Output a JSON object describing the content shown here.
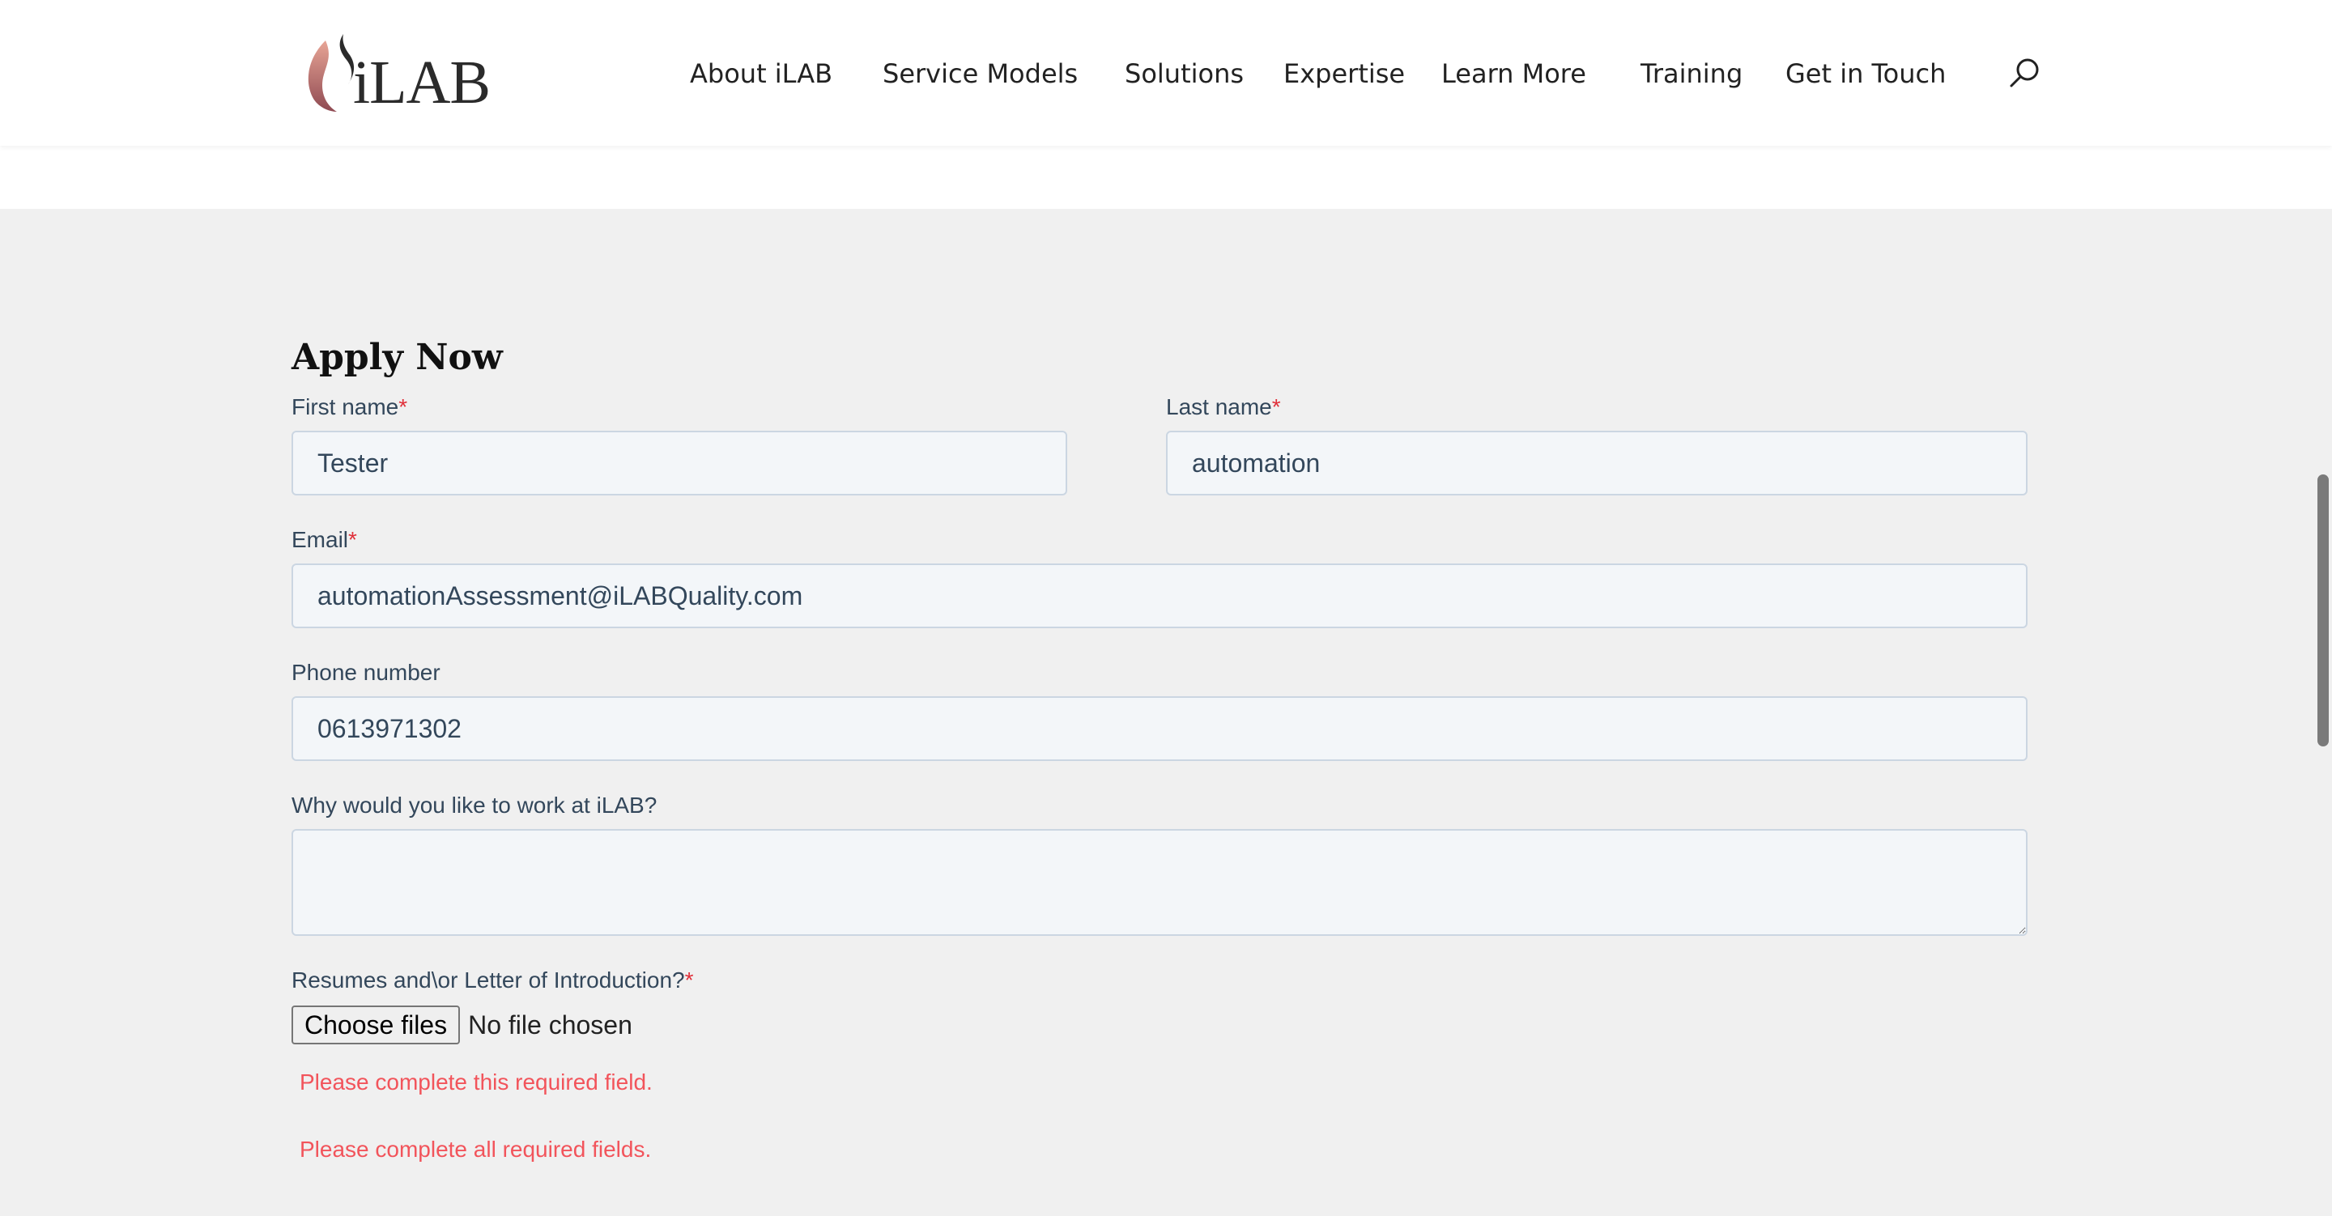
{
  "header": {
    "logo_text": "iLAB",
    "nav": [
      {
        "label": "About iLAB"
      },
      {
        "label": "Service Models"
      },
      {
        "label": "Solutions"
      },
      {
        "label": "Expertise"
      },
      {
        "label": "Learn More"
      },
      {
        "label": "Training"
      },
      {
        "label": "Get in Touch"
      }
    ],
    "search_icon": "search-icon"
  },
  "form": {
    "title": "Apply Now",
    "required_marker": "*",
    "first_name": {
      "label": "First name",
      "value": "Tester"
    },
    "last_name": {
      "label": "Last name",
      "value": "automation"
    },
    "email": {
      "label": "Email",
      "value": "automationAssessment@iLABQuality.com"
    },
    "phone": {
      "label": "Phone number",
      "value": "0613971302"
    },
    "why": {
      "label": "Why would you like to work at iLAB?",
      "value": ""
    },
    "resume": {
      "label": "Resumes and\\or Letter of Introduction?",
      "button": "Choose files",
      "status": "No file chosen"
    },
    "errors": {
      "field": "Please complete this required field.",
      "form": "Please complete all required fields."
    }
  },
  "colors": {
    "accent_required": "#e0303a",
    "error": "#f2545b",
    "input_bg": "#f3f6f9",
    "input_border": "#cbd6e2",
    "page_bg": "#f0f0f0"
  }
}
